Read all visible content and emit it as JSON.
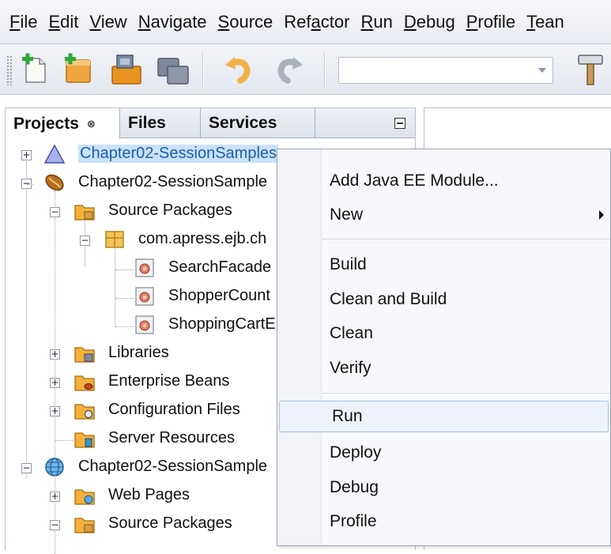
{
  "menubar": {
    "items": [
      {
        "label": "File",
        "ul": "F",
        "rest": "ile"
      },
      {
        "label": "Edit",
        "ul": "E",
        "rest": "dit"
      },
      {
        "label": "View",
        "ul": "V",
        "rest": "iew"
      },
      {
        "label": "Navigate",
        "ul": "N",
        "rest": "avigate"
      },
      {
        "label": "Source",
        "ul": "S",
        "rest": "ource"
      },
      {
        "label": "Refactor",
        "pre": "Ref",
        "ul": "a",
        "rest": "ctor"
      },
      {
        "label": "Run",
        "ul": "R",
        "rest": "un"
      },
      {
        "label": "Debug",
        "ul": "D",
        "rest": "ebug"
      },
      {
        "label": "Profile",
        "ul": "P",
        "rest": "rofile"
      },
      {
        "label": "Team",
        "ul": "T",
        "rest": "ean"
      }
    ]
  },
  "toolbar": {
    "icons": [
      "new-file-icon",
      "new-project-icon",
      "open-project-icon",
      "close-project-icon",
      "undo-icon",
      "redo-icon",
      "build-hammer-icon"
    ],
    "config_combo_value": ""
  },
  "panel": {
    "tabs": [
      {
        "label": "Projects",
        "close": "⊗",
        "active": true
      },
      {
        "label": "Files"
      },
      {
        "label": "Services"
      }
    ]
  },
  "tree": {
    "nodes": [
      {
        "label": "Chapter02-SessionSamples",
        "selected": true
      },
      {
        "label": "Chapter02-SessionSample"
      },
      {
        "label": "Source Packages"
      },
      {
        "label": "com.apress.ejb.ch"
      },
      {
        "label": "SearchFacade"
      },
      {
        "label": "ShopperCount"
      },
      {
        "label": "ShoppingCartE"
      },
      {
        "label": "Libraries"
      },
      {
        "label": "Enterprise Beans"
      },
      {
        "label": "Configuration Files"
      },
      {
        "label": "Server Resources"
      },
      {
        "label": "Chapter02-SessionSample"
      },
      {
        "label": "Web Pages"
      },
      {
        "label": "Source Packages"
      }
    ]
  },
  "context_menu": {
    "items": [
      {
        "label": "Add Java EE Module..."
      },
      {
        "label": "New",
        "submenu": true
      },
      {
        "label": "Build"
      },
      {
        "label": "Clean and Build"
      },
      {
        "label": "Clean"
      },
      {
        "label": "Verify"
      },
      {
        "label": "Run",
        "highlighted": true
      },
      {
        "label": "Deploy"
      },
      {
        "label": "Debug"
      },
      {
        "label": "Profile"
      }
    ]
  },
  "colors": {
    "selection_bg": "#c9e1fb",
    "selection_text": "#1f5fa8",
    "menu_highlight_border": "#a9bfdc"
  }
}
